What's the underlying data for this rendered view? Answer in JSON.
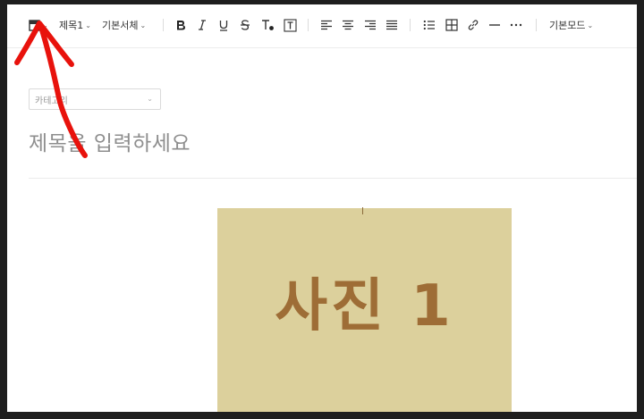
{
  "toolbar": {
    "heading": "제목1",
    "font": "기본서체",
    "mode": "기본모드",
    "chevron": "⌄"
  },
  "editor": {
    "category_label": "카테고리",
    "title_placeholder": "제목을 입력하세요",
    "photo_label": "사진 1"
  },
  "colors": {
    "annotation": "#e8120c",
    "photo_bg": "#dcd09c",
    "photo_text": "#9e6d36"
  }
}
